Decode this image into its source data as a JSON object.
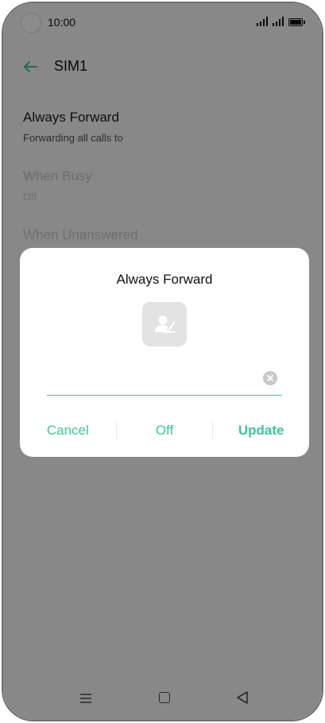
{
  "status_bar": {
    "time": "10:00",
    "icons": [
      "camera-cutout",
      "signal-icon",
      "signal-icon",
      "battery-icon"
    ]
  },
  "toolbar": {
    "back_icon": "arrow-left-icon",
    "title": "SIM1"
  },
  "settings": {
    "items": [
      {
        "title": "Always Forward",
        "subtitle": "Forwarding all calls to",
        "enabled": true
      },
      {
        "title": "When Busy",
        "subtitle": "Off",
        "enabled": false
      },
      {
        "title": "When Unanswered",
        "subtitle": "",
        "enabled": false
      }
    ]
  },
  "dialog": {
    "title": "Always Forward",
    "contact_icon": "contact-picker-icon",
    "input": {
      "value": "",
      "placeholder": ""
    },
    "clear_icon": "clear-icon",
    "actions": {
      "cancel_label": "Cancel",
      "off_label": "Off",
      "update_label": "Update"
    }
  },
  "nav_bar": {
    "icons": [
      "menu-icon",
      "home-icon",
      "back-icon"
    ]
  },
  "colors": {
    "accent": "#3ec59a",
    "scrim": "#000000",
    "dialog_bg": "#ffffff"
  }
}
